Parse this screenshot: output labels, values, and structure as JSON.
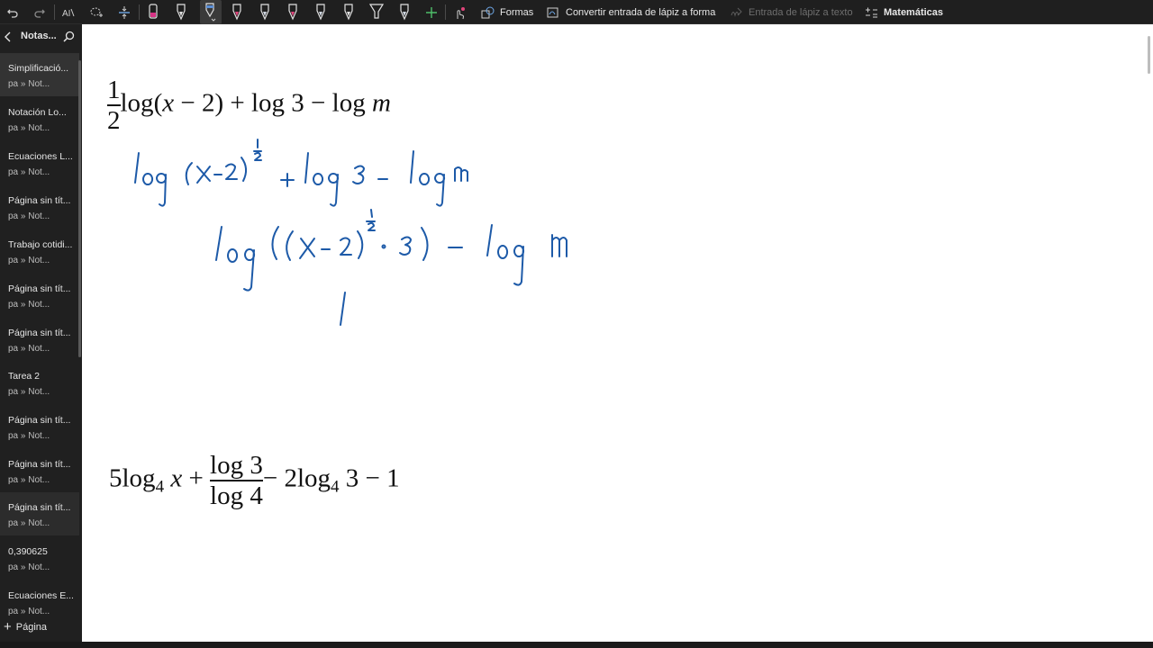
{
  "toolbar": {
    "formas_label": "Formas",
    "convert_shape_label": "Convertir entrada de lápiz a forma",
    "ink_to_text_label": "Entrada de lápiz a texto",
    "math_label": "Matemáticas",
    "pen_colors": [
      "#d63384",
      "#1e1e1e",
      "#5b8fd6",
      "#e0457b",
      "#cfd6e0",
      "#e0457b",
      "#cfd6e0",
      "#cfd6e0",
      "#cfd6e0",
      "#cfd6e0"
    ]
  },
  "pane": {
    "title": "Notas...",
    "pages": [
      {
        "title": "Simplificació...",
        "sub": "pa » Not..."
      },
      {
        "title": "Notación Lo...",
        "sub": "pa » Not..."
      },
      {
        "title": "Ecuaciones L...",
        "sub": "pa » Not..."
      },
      {
        "title": "Página sin tít...",
        "sub": "pa » Not..."
      },
      {
        "title": "Trabajo cotidi...",
        "sub": "pa » Not..."
      },
      {
        "title": "Página sin tít...",
        "sub": "pa » Not..."
      },
      {
        "title": "Página sin tít...",
        "sub": "pa » Not..."
      },
      {
        "title": "Tarea 2",
        "sub": "pa » Not..."
      },
      {
        "title": "Página sin tít...",
        "sub": "pa » Not..."
      },
      {
        "title": "Página sin tít...",
        "sub": "pa » Not..."
      },
      {
        "title": "Página sin tít...",
        "sub": "pa » Not..."
      },
      {
        "title": "0,390625",
        "sub": "pa » Not..."
      },
      {
        "title": "Ecuaciones E...",
        "sub": "pa » Not..."
      }
    ],
    "add_page_label": "Página"
  },
  "canvas": {
    "expr1": {
      "frac_num": "1",
      "frac_den": "2",
      "log1": "log",
      "open": "(",
      "x": "x",
      "minus2": " − 2) + log 3 − log ",
      "m": "m"
    },
    "expr2": {
      "coef": "5log",
      "base": "4",
      "x": "x",
      "plus": "+",
      "num": "log 3",
      "den": "log 4",
      "rest": "− 2log",
      "base2": "4",
      "tail": "3 − 1"
    },
    "ink_color": "#1d5aa8"
  }
}
